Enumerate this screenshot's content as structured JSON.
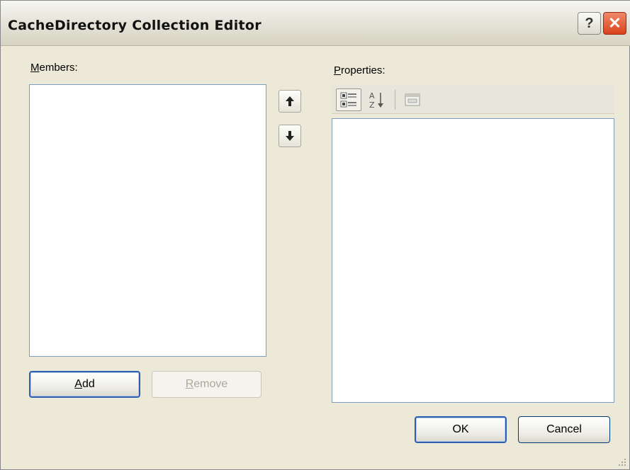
{
  "window": {
    "title": "CacheDirectory Collection Editor",
    "help_label": "?",
    "close_label": "✕"
  },
  "members": {
    "label_accel": "M",
    "label_rest": "embers:"
  },
  "properties": {
    "label_accel": "P",
    "label_rest": "roperties:"
  },
  "buttons": {
    "add_accel": "A",
    "add_rest": "dd",
    "remove_accel": "R",
    "remove_rest": "emove",
    "ok": "OK",
    "cancel": "Cancel"
  },
  "icons": {
    "move_up": "arrow-up-icon",
    "move_down": "arrow-down-icon",
    "categorized": "categorized-icon",
    "alphabetical": "alphabetical-sort-icon",
    "property_pages": "property-pages-icon"
  }
}
